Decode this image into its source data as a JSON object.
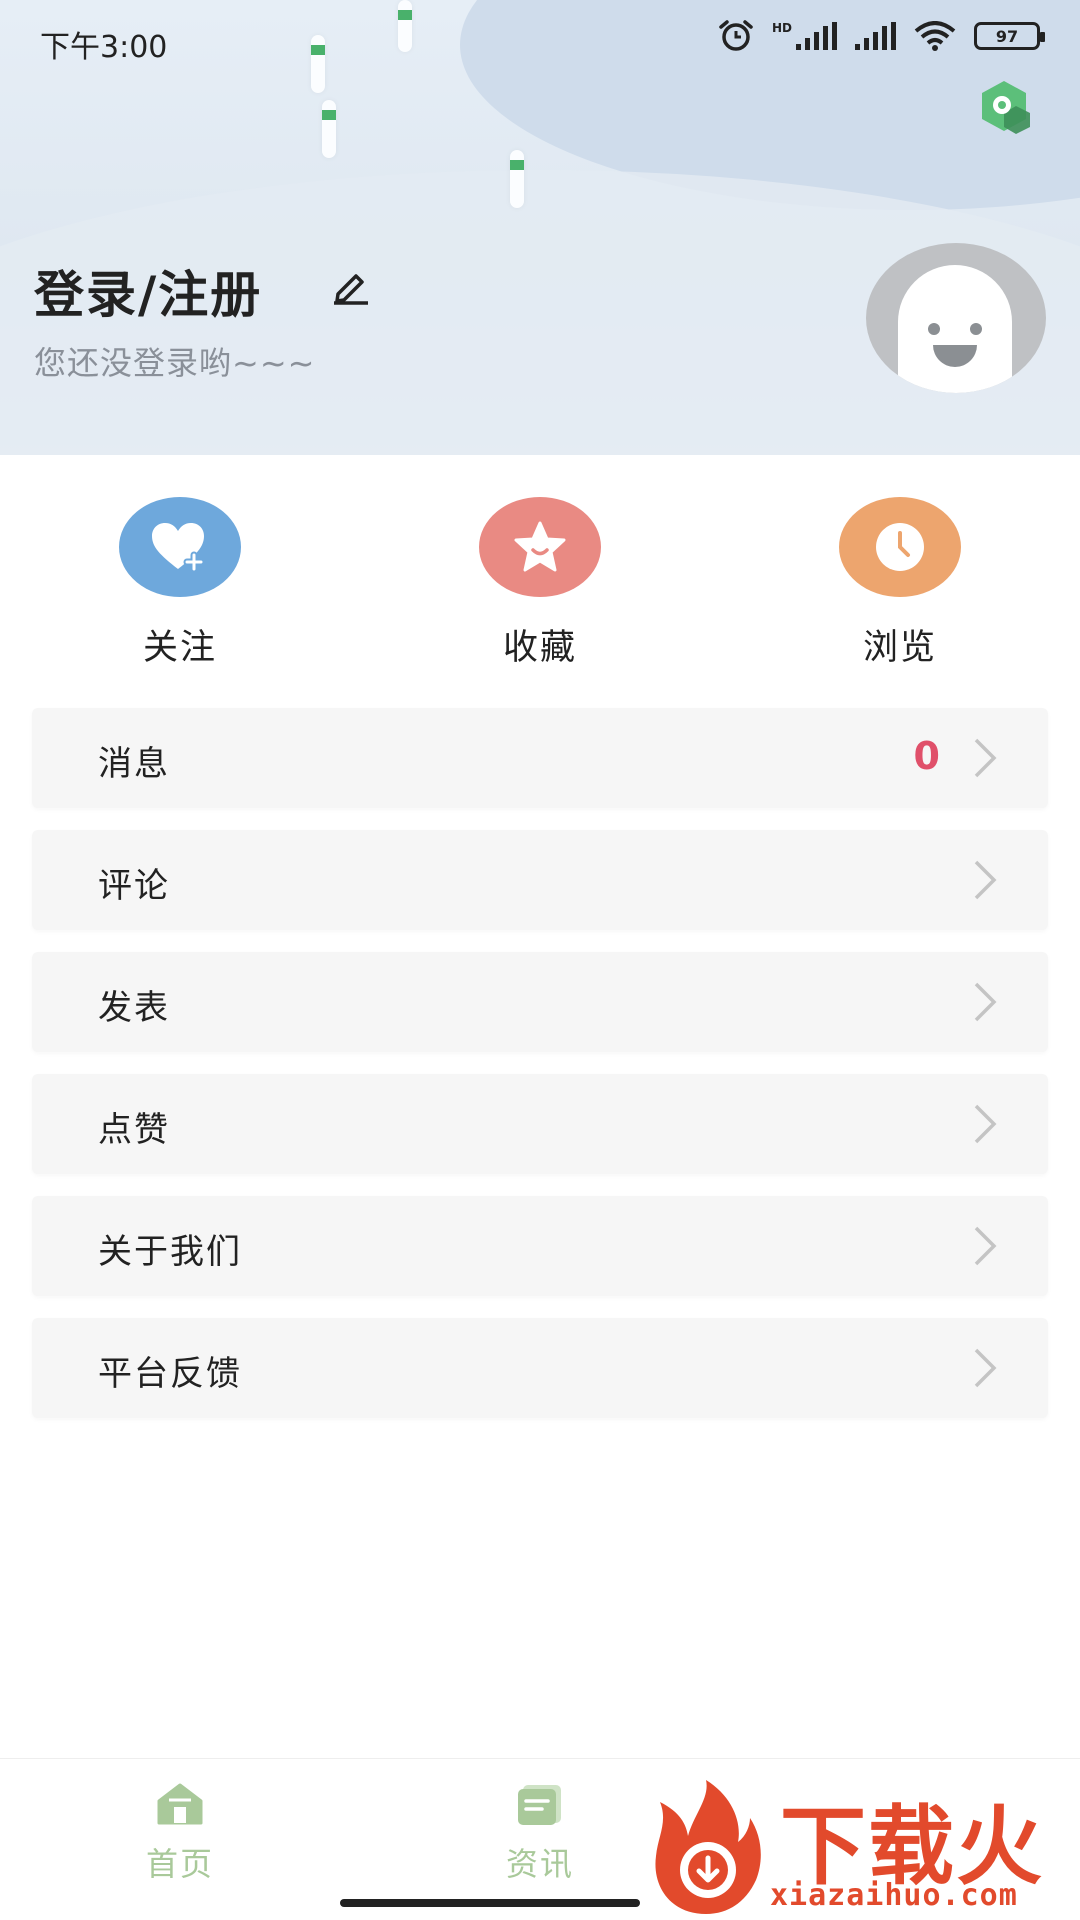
{
  "status_bar": {
    "time": "下午3:00",
    "hd_label": "HD",
    "battery": "97"
  },
  "profile": {
    "title": "登录/注册",
    "subtitle": "您还没登录哟~~~"
  },
  "quick_actions": [
    {
      "label": "关注",
      "icon": "heart-plus-icon",
      "color": "#6ea8dc"
    },
    {
      "label": "收藏",
      "icon": "star-icon",
      "color": "#e98a83"
    },
    {
      "label": "浏览",
      "icon": "clock-icon",
      "color": "#eda56e"
    }
  ],
  "menu": [
    {
      "label": "消息",
      "badge": "0"
    },
    {
      "label": "评论"
    },
    {
      "label": "发表"
    },
    {
      "label": "点赞"
    },
    {
      "label": "关于我们"
    },
    {
      "label": "平台反馈"
    }
  ],
  "bottom_nav": [
    {
      "label": "首页",
      "icon": "home-icon"
    },
    {
      "label": "资讯",
      "icon": "news-icon"
    }
  ],
  "watermark": {
    "text": "下载火",
    "domain": "xiazaihuo.com"
  },
  "colors": {
    "accent_green": "#a9c99a",
    "badge_red": "#e0506a",
    "watermark_red": "#e24a2c"
  }
}
